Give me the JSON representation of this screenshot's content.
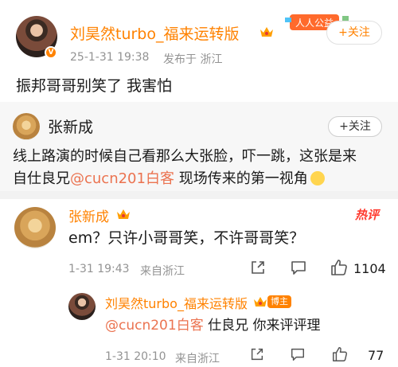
{
  "post": {
    "author": "刘昊然turbo_福来运转版",
    "timestamp": "25-1-31 19:38",
    "source": "发布于 浙江",
    "content": "振邦哥哥别笑了 我害怕",
    "follow_label": "+关注",
    "banner_text": "人人公益"
  },
  "repost": {
    "author": "张新成",
    "follow_label": "+关注",
    "line1": "线上路演的时候自己看那么大张脸，吓一跳，这张是来",
    "line2_prefix": "自仕良兄",
    "mention": "@cucn201白客",
    "line2_suffix": " 现场传来的第一视角"
  },
  "comment": {
    "author": "张新成",
    "hot_label": "热评",
    "content": "em？只许小哥哥笑，不许哥哥笑？",
    "timestamp": "1-31 19:43",
    "source": "来自浙江",
    "like_count": "1104"
  },
  "reply": {
    "author": "刘昊然turbo_福来运转版",
    "host_badge": "博主",
    "mention": "@cucn201白客",
    "content_suffix": " 仕良兄 你来评评理",
    "timestamp": "1-31 20:10",
    "source": "来自浙江",
    "like_count": "77"
  }
}
